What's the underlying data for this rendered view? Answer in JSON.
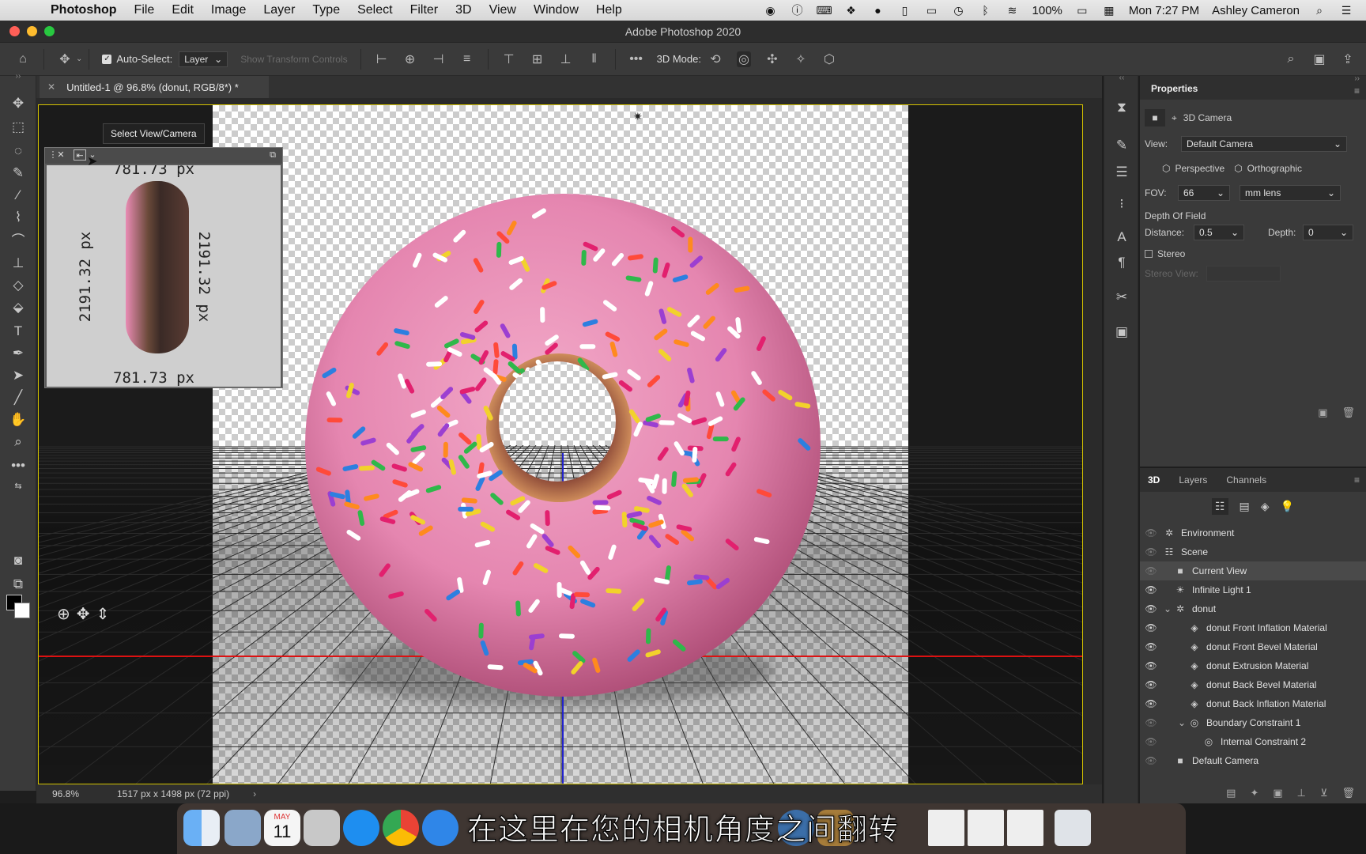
{
  "menubar": {
    "app": "Photoshop",
    "items": [
      "File",
      "Edit",
      "Image",
      "Layer",
      "Type",
      "Select",
      "Filter",
      "3D",
      "View",
      "Window",
      "Help"
    ],
    "battery": "100%",
    "datetime": "Mon 7:27 PM",
    "user": "Ashley Cameron"
  },
  "window": {
    "title": "Adobe Photoshop 2020"
  },
  "options": {
    "auto_select_label": "Auto-Select:",
    "auto_select_value": "Layer",
    "transform_label": "Show Transform Controls",
    "mode_label": "3D Mode:"
  },
  "document": {
    "tab_title": "Untitled-1 @ 96.8% (donut, RGB/8*) *"
  },
  "tooltip": "Select View/Camera",
  "secondary_view": {
    "top_dim": "781.73 px",
    "bottom_dim": "781.73 px",
    "left_dim": "2191.32 px",
    "right_dim": "2191.32 px"
  },
  "status": {
    "zoom": "96.8%",
    "doc_size": "1517 px x 1498 px (72 ppi)"
  },
  "properties": {
    "tab": "Properties",
    "camera_label": "3D Camera",
    "view_label": "View:",
    "view_value": "Default Camera",
    "perspective": "Perspective",
    "orthographic": "Orthographic",
    "fov_label": "FOV:",
    "fov_value": "66",
    "lens_value": "mm lens",
    "dof_label": "Depth Of Field",
    "distance_label": "Distance:",
    "distance_value": "0.5",
    "depth_label": "Depth:",
    "depth_value": "0",
    "stereo_label": "Stereo",
    "stereo_view_label": "Stereo View:"
  },
  "panel3d": {
    "tabs": [
      "3D",
      "Layers",
      "Channels"
    ],
    "rows": [
      {
        "label": "Environment"
      },
      {
        "label": "Scene"
      },
      {
        "label": "Current View"
      },
      {
        "label": "Infinite Light 1"
      },
      {
        "label": "donut"
      },
      {
        "label": "donut Front Inflation Material"
      },
      {
        "label": "donut Front Bevel Material"
      },
      {
        "label": "donut Extrusion Material"
      },
      {
        "label": "donut Back Bevel Material"
      },
      {
        "label": "donut Back Inflation Material"
      },
      {
        "label": "Boundary Constraint 1"
      },
      {
        "label": "Internal Constraint 2"
      },
      {
        "label": "Default Camera"
      }
    ]
  },
  "subtitle": "在这里在您的相机角度之间翻转",
  "dock_calendar": {
    "month": "MAY",
    "day": "11"
  },
  "colors": {
    "accent_yellow": "#d3c200",
    "axis_red": "#dd1111",
    "axis_blue": "#2222cc",
    "donut_pink": "#e58fb4"
  }
}
